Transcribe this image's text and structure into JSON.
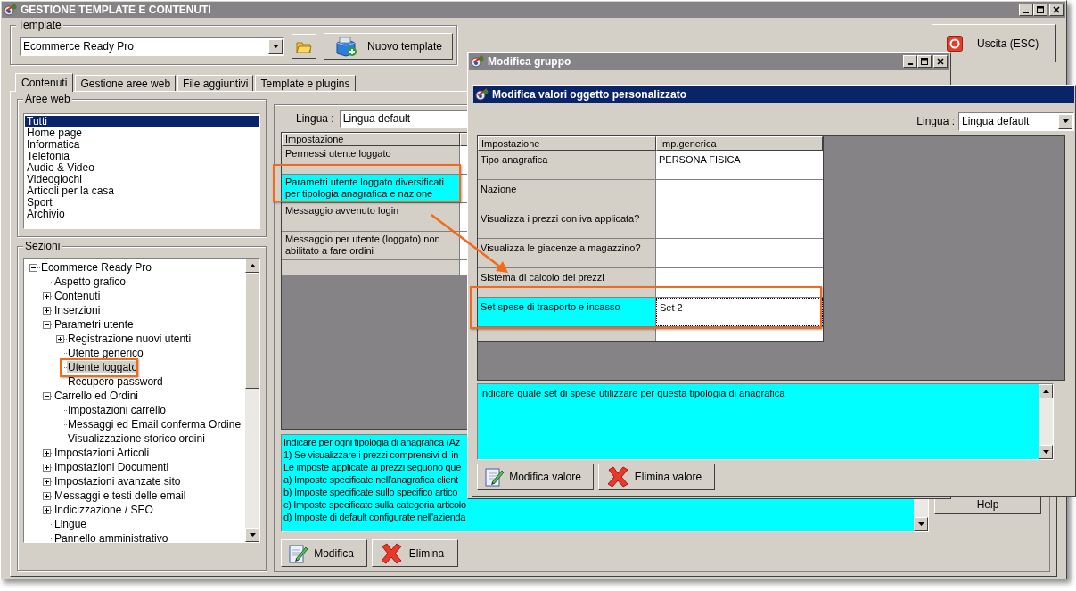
{
  "main_window": {
    "title": "GESTIONE TEMPLATE E CONTENUTI",
    "active": false
  },
  "template": {
    "label": "Template",
    "value": "Ecommerce Ready Pro",
    "new_button": "Nuovo template"
  },
  "exit_button": "Uscita (ESC)",
  "tabs": [
    {
      "label": "Contenuti",
      "selected": true
    },
    {
      "label": "Gestione aree web",
      "selected": false
    },
    {
      "label": "File aggiuntivi",
      "selected": false
    },
    {
      "label": "Template e plugins",
      "selected": false
    }
  ],
  "web_areas": {
    "label": "Aree web",
    "items": [
      {
        "label": "Tutti",
        "selected": true
      },
      {
        "label": "Home page",
        "selected": false
      },
      {
        "label": "Informatica",
        "selected": false
      },
      {
        "label": "Telefonia",
        "selected": false
      },
      {
        "label": "Audio & Video",
        "selected": false
      },
      {
        "label": "Videogiochi",
        "selected": false
      },
      {
        "label": "Articoli per la casa",
        "selected": false
      },
      {
        "label": "Sport",
        "selected": false
      },
      {
        "label": "Archivio",
        "selected": false
      }
    ]
  },
  "sections": {
    "label": "Sezioni",
    "tree": [
      {
        "label": "Ecommerce Ready Pro",
        "kind": "branch",
        "expanded": true,
        "selected": false,
        "children": [
          {
            "label": "Aspetto grafico",
            "kind": "leaf",
            "selected": false
          },
          {
            "label": "Contenuti",
            "kind": "branch",
            "expanded": false,
            "selected": false
          },
          {
            "label": "Inserzioni",
            "kind": "branch",
            "expanded": false,
            "selected": false
          },
          {
            "label": "Parametri utente",
            "kind": "branch",
            "expanded": true,
            "selected": false,
            "children": [
              {
                "label": "Registrazione nuovi utenti",
                "kind": "branch",
                "expanded": false,
                "selected": false
              },
              {
                "label": "Utente generico",
                "kind": "leaf",
                "selected": false
              },
              {
                "label": "Utente loggato",
                "kind": "leaf",
                "selected": true
              },
              {
                "label": "Recupero password",
                "kind": "leaf",
                "selected": false
              }
            ]
          },
          {
            "label": "Carrello ed Ordini",
            "kind": "branch",
            "expanded": true,
            "selected": false,
            "children": [
              {
                "label": "Impostazioni carrello",
                "kind": "leaf",
                "selected": false
              },
              {
                "label": "Messaggi ed Email conferma Ordine",
                "kind": "leaf",
                "selected": false
              },
              {
                "label": "Visualizzazione storico ordini",
                "kind": "leaf",
                "selected": false
              }
            ]
          },
          {
            "label": "Impostazioni Articoli",
            "kind": "branch",
            "expanded": false,
            "selected": false
          },
          {
            "label": "Impostazioni Documenti",
            "kind": "branch",
            "expanded": false,
            "selected": false
          },
          {
            "label": "Impostazioni avanzate sito",
            "kind": "branch",
            "expanded": false,
            "selected": false
          },
          {
            "label": "Messaggi e testi delle email",
            "kind": "branch",
            "expanded": false,
            "selected": false
          },
          {
            "label": "Indicizzazione / SEO",
            "kind": "branch",
            "expanded": false,
            "selected": false
          },
          {
            "label": "Lingue",
            "kind": "leaf",
            "selected": false
          },
          {
            "label": "Pannello amministrativo",
            "kind": "leaf",
            "selected": false
          }
        ]
      }
    ]
  },
  "settings": {
    "language_label": "Lingua :",
    "language": "Lingua default",
    "columns": [
      "Impostazione"
    ],
    "rows": [
      {
        "label": "Permessi utente loggato",
        "selected": false
      },
      {
        "label": "Parametri utente loggato diversificati per tipologia anagrafica e nazione",
        "selected": true
      },
      {
        "label": "Messaggio avvenuto login",
        "selected": false
      },
      {
        "label": "Messaggio per utente (loggato) non abilitato a fare ordini",
        "selected": false
      }
    ],
    "description_lines": [
      "Indicare per ogni tipologia di anagrafica (Az",
      "1) Se visualizzare i prezzi comprensivi di in",
      "Le imposte applicate ai prezzi seguono que",
      "a) Imposte specificate nell'anagrafica client",
      "b) Imposte specificate sullo specifico artico",
      "c) Imposte specificate sulla categoria articolo",
      "d) Imposte di default configurate nell'azienda"
    ],
    "edit_button": "Modifica",
    "delete_button": "Elimina"
  },
  "help_button": "Help",
  "group_dialog": {
    "title": "Modifica gruppo",
    "active": false
  },
  "values_dialog": {
    "title": "Modifica valori oggetto personalizzato",
    "active": true,
    "language_label": "Lingua :",
    "language": "Lingua default",
    "columns": [
      "Impostazione",
      "Imp.generica"
    ],
    "rows": [
      {
        "label": "Tipo anagrafica",
        "value": "PERSONA FISICA",
        "selected": false
      },
      {
        "label": "Nazione",
        "selected": false
      },
      {
        "label": "Visualizza i prezzi con iva applicata?",
        "selected": false
      },
      {
        "label": "Visualizza le giacenze a magazzino?",
        "selected": false
      },
      {
        "label": "Sistema di calcolo dei prezzi",
        "selected": false
      },
      {
        "label": "Set spese di trasporto e incasso",
        "value": "Set 2",
        "selected": true
      }
    ],
    "description": "Indicare quale set di spese utilizzare per questa tipologia di anagrafica",
    "edit_button": "Modifica valore",
    "delete_button": "Elimina valore"
  }
}
